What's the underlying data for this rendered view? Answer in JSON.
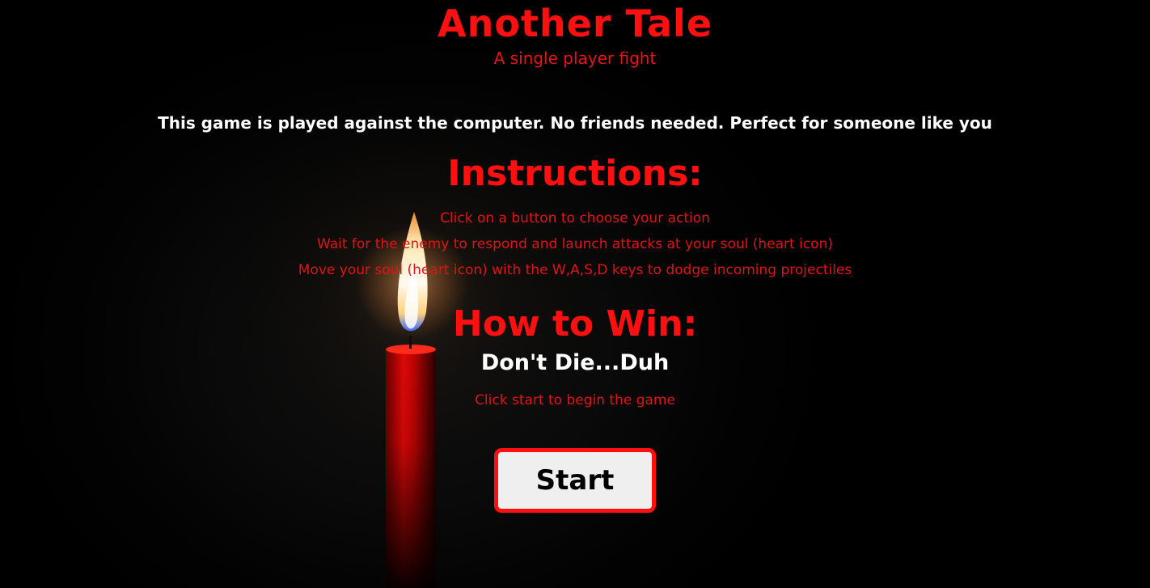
{
  "header": {
    "title": "Another Tale",
    "subtitle": "A single player fight"
  },
  "intro": "This game is played against the computer. No friends needed. Perfect for someone like you",
  "instructions": {
    "heading": "Instructions:",
    "items": [
      "Click on a button to choose your action",
      "Wait for the enemy to respond and launch attacks at your soul (heart icon)",
      "Move your soul (heart icon) with the W,A,S,D keys to dodge incoming projectiles"
    ]
  },
  "win": {
    "heading": "How to Win:",
    "text": "Don't Die...Duh"
  },
  "begin_text": "Click start to begin the game",
  "start_button": {
    "label": "Start"
  },
  "colors": {
    "accent": "#ff1010",
    "text_light": "#ffffff",
    "background": "#000000",
    "button_bg": "#efefef",
    "button_border": "#ff0f0f"
  },
  "background_image": {
    "icon": "candle-icon"
  }
}
